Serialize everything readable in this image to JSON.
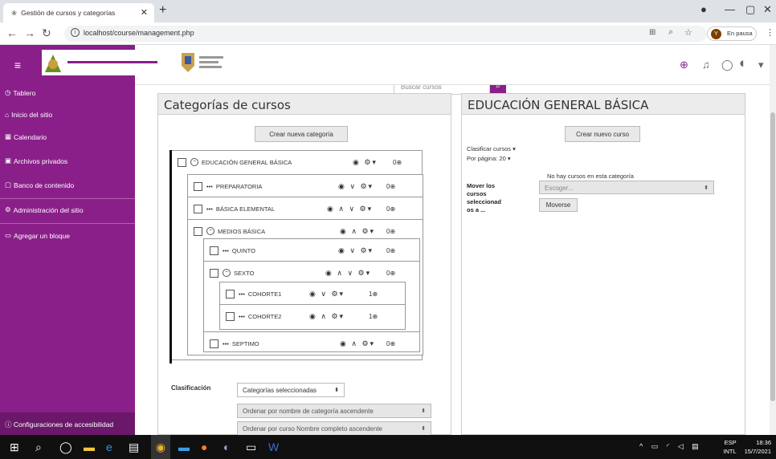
{
  "browser": {
    "tab_title": "Gestión de cursos y categorías",
    "url": "localhost/course/management.php",
    "pause_label": "En pausa"
  },
  "sidebar": {
    "items": [
      {
        "label": "Tablero",
        "icon": "dashboard-icon"
      },
      {
        "label": "Inicio del sitio",
        "icon": "home-icon"
      },
      {
        "label": "Calendario",
        "icon": "calendar-icon"
      },
      {
        "label": "Archivos privados",
        "icon": "files-icon"
      },
      {
        "label": "Banco de contenido",
        "icon": "content-bank-icon"
      },
      {
        "label": "Administración del sitio",
        "icon": "gear-icon"
      },
      {
        "label": "Agregar un bloque",
        "icon": "add-block-icon"
      }
    ],
    "accessibility": "Configuraciones de accesibilidad"
  },
  "search": {
    "placeholder": "Buscar cursos"
  },
  "categories_panel": {
    "title": "Categorías de cursos",
    "create_button": "Crear nueva categoría",
    "tree": [
      {
        "label": "EDUCACIÓN GENERAL BÁSICA",
        "count": "0",
        "level": 0,
        "expanded": true
      },
      {
        "label": "PREPARATORIA",
        "count": "0",
        "level": 1
      },
      {
        "label": "BÁSICA ELEMENTAL",
        "count": "0",
        "level": 1
      },
      {
        "label": "MEDIOS BÁSICA",
        "count": "0",
        "level": 1,
        "expanded": true
      },
      {
        "label": "QUINTO",
        "count": "0",
        "level": 2
      },
      {
        "label": "SEXTO",
        "count": "0",
        "level": 2,
        "expanded": true
      },
      {
        "label": "COHORTE1",
        "count": "1",
        "level": 3
      },
      {
        "label": "COHORTE2",
        "count": "1",
        "level": 3
      },
      {
        "label": "SEPTIMO",
        "count": "0",
        "level": 2
      }
    ],
    "sort_label": "Clasificación",
    "sort_select": "Categorías seleccionadas",
    "sort_option1": "Ordenar por nombre de categoría ascendente",
    "sort_option2": "Ordenar por curso Nombre completo ascendente"
  },
  "courses_panel": {
    "title": "EDUCACIÓN GENERAL BÁSICA",
    "create_button": "Crear nuevo curso",
    "sort_courses": "Clasificar cursos",
    "per_page": "Por página: 20",
    "no_courses": "No hay cursos en esta categoría",
    "move_label": "Mover los cursos seleccionad os a ...",
    "choose_placeholder": "Escoger...",
    "move_button": "Moverse"
  },
  "taskbar": {
    "lang": "ESP",
    "layout": "INTL",
    "time": "18:36",
    "date": "15/7/2021"
  },
  "colors": {
    "accent": "#8a1f8a"
  }
}
